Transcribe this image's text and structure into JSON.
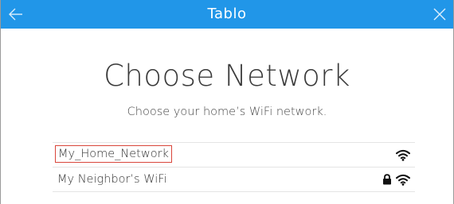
{
  "header": {
    "brand": "Tablo",
    "back_icon": "arrow-left-icon",
    "close_icon": "close-icon",
    "bar_color": "#2196e8"
  },
  "main": {
    "title": "Choose Network",
    "subtitle": "Choose your home’s WiFi network."
  },
  "networks": [
    {
      "name": "My_Home_Network",
      "secured": false,
      "selected": true,
      "signal_icon": "wifi-icon"
    },
    {
      "name": "My Neighbor’s WiFi",
      "secured": true,
      "selected": false,
      "signal_icon": "wifi-icon"
    }
  ],
  "colors": {
    "selection_outline": "#d9453a",
    "text": "#333333"
  }
}
